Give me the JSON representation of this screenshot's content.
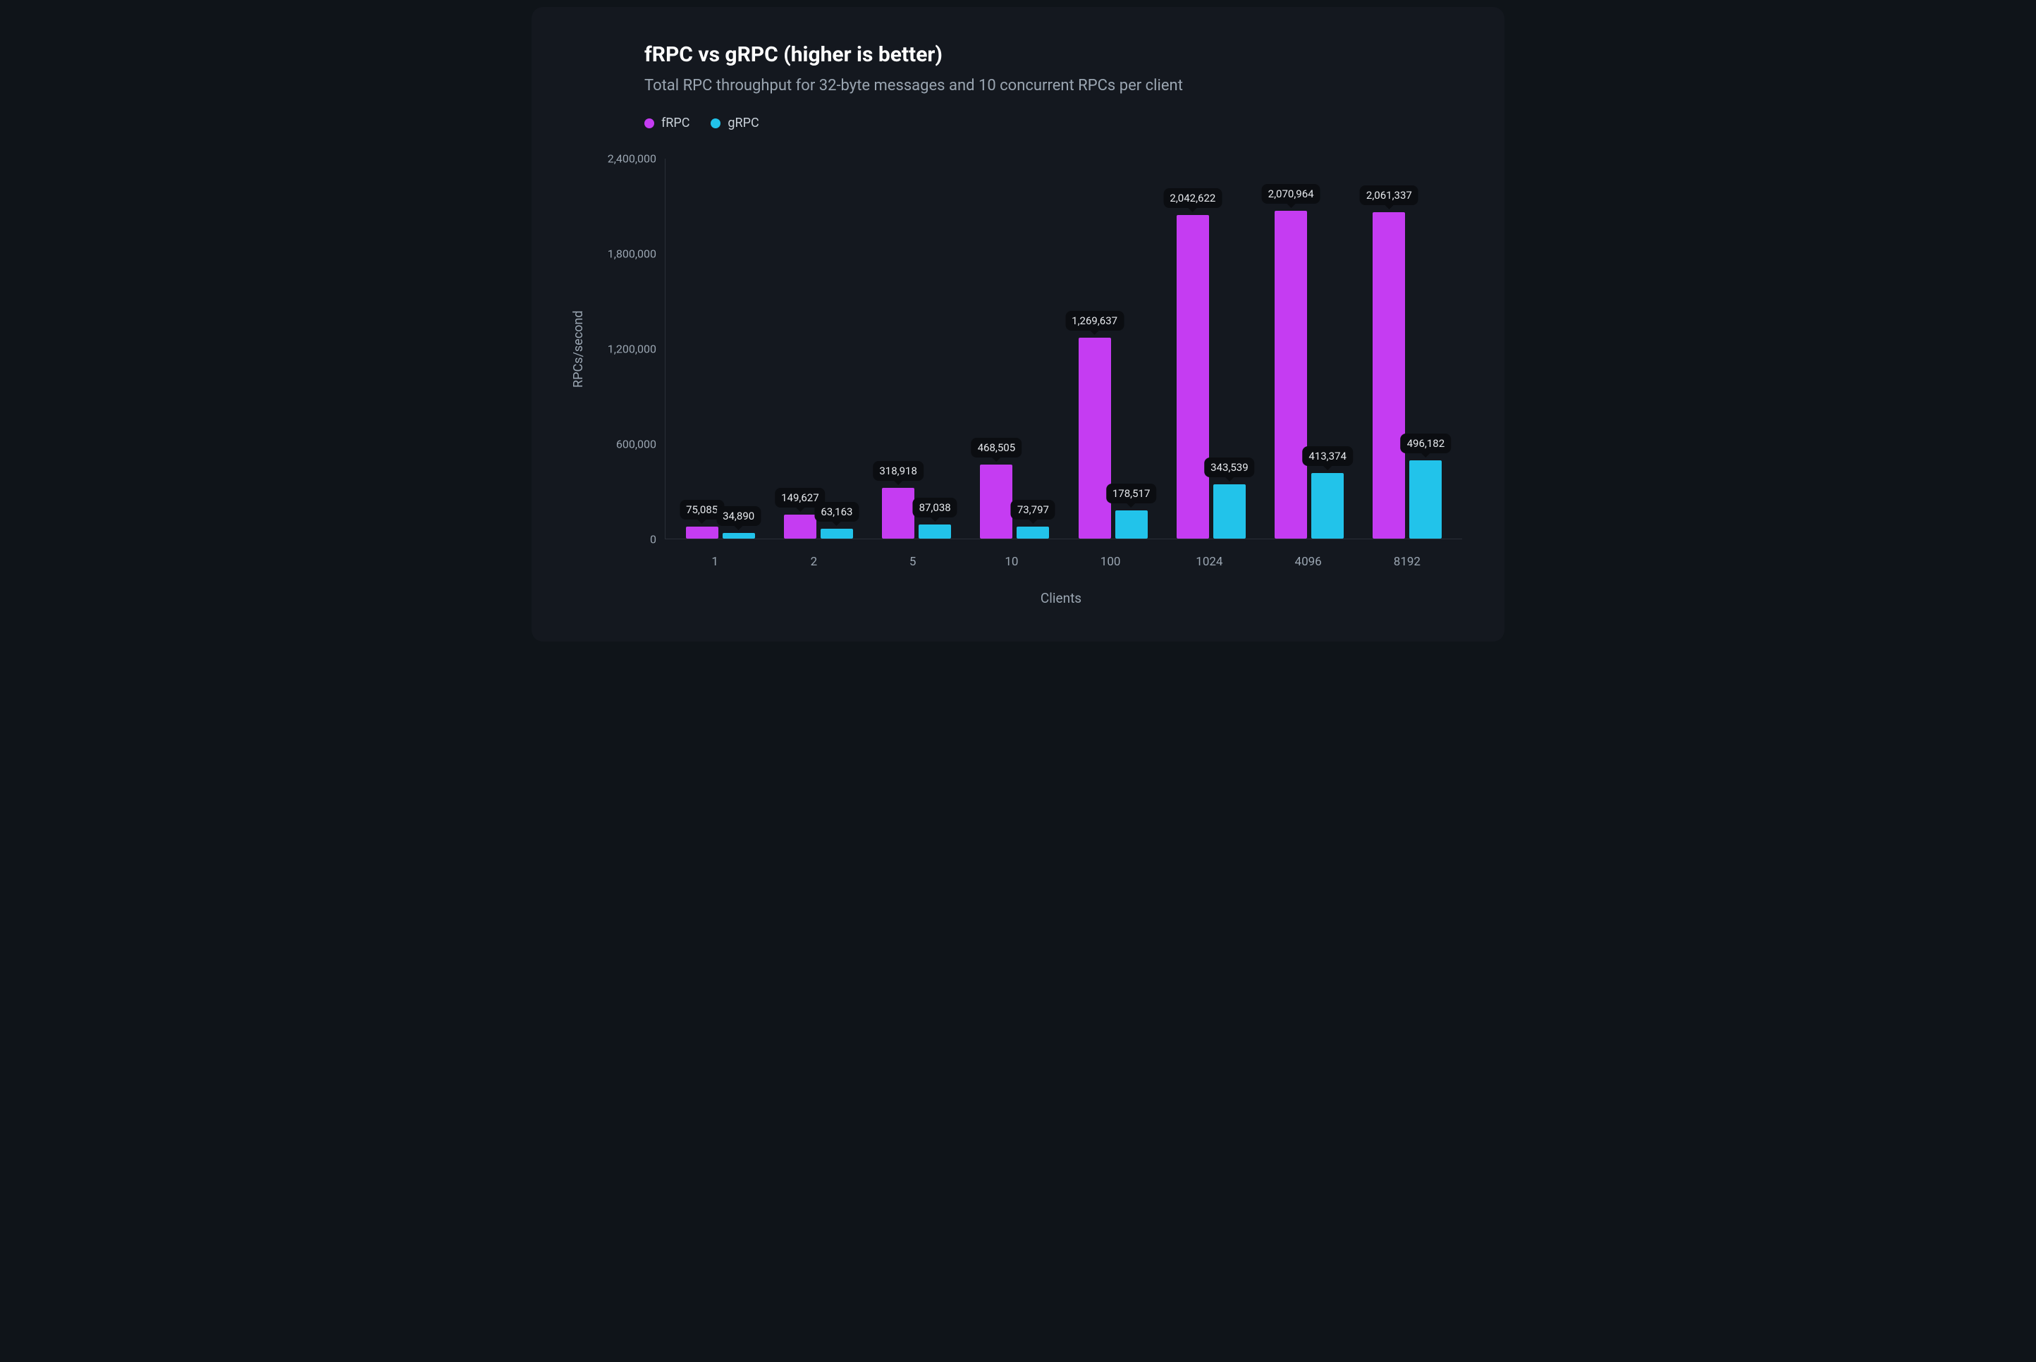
{
  "title": "fRPC vs gRPC (higher is better)",
  "subtitle": "Total RPC throughput for 32-byte messages and 10 concurrent RPCs per client",
  "legend": [
    {
      "name": "fRPC",
      "color": "#c53cf2"
    },
    {
      "name": "gRPC",
      "color": "#22c3ea"
    }
  ],
  "ylabel": "RPCs/second",
  "xlabel": "Clients",
  "y_ticks": [
    {
      "label": "0",
      "value": 0
    },
    {
      "label": "600,000",
      "value": 600000
    },
    {
      "label": "1,200,000",
      "value": 1200000
    },
    {
      "label": "1,800,000",
      "value": 1800000
    },
    {
      "label": "2,400,000",
      "value": 2400000
    }
  ],
  "chart_data": {
    "type": "bar",
    "title": "fRPC vs gRPC (higher is better)",
    "subtitle": "Total RPC throughput for 32-byte messages and 10 concurrent RPCs per client",
    "xlabel": "Clients",
    "ylabel": "RPCs/second",
    "ylim": [
      0,
      2400000
    ],
    "categories": [
      "1",
      "2",
      "5",
      "10",
      "100",
      "1024",
      "4096",
      "8192"
    ],
    "series": [
      {
        "name": "fRPC",
        "color": "#c53cf2",
        "values": [
          75085,
          149627,
          318918,
          468505,
          1269637,
          2042622,
          2070964,
          2061337
        ]
      },
      {
        "name": "gRPC",
        "color": "#22c3ea",
        "values": [
          34890,
          63163,
          87038,
          73797,
          178517,
          343539,
          413374,
          496182
        ]
      }
    ]
  }
}
